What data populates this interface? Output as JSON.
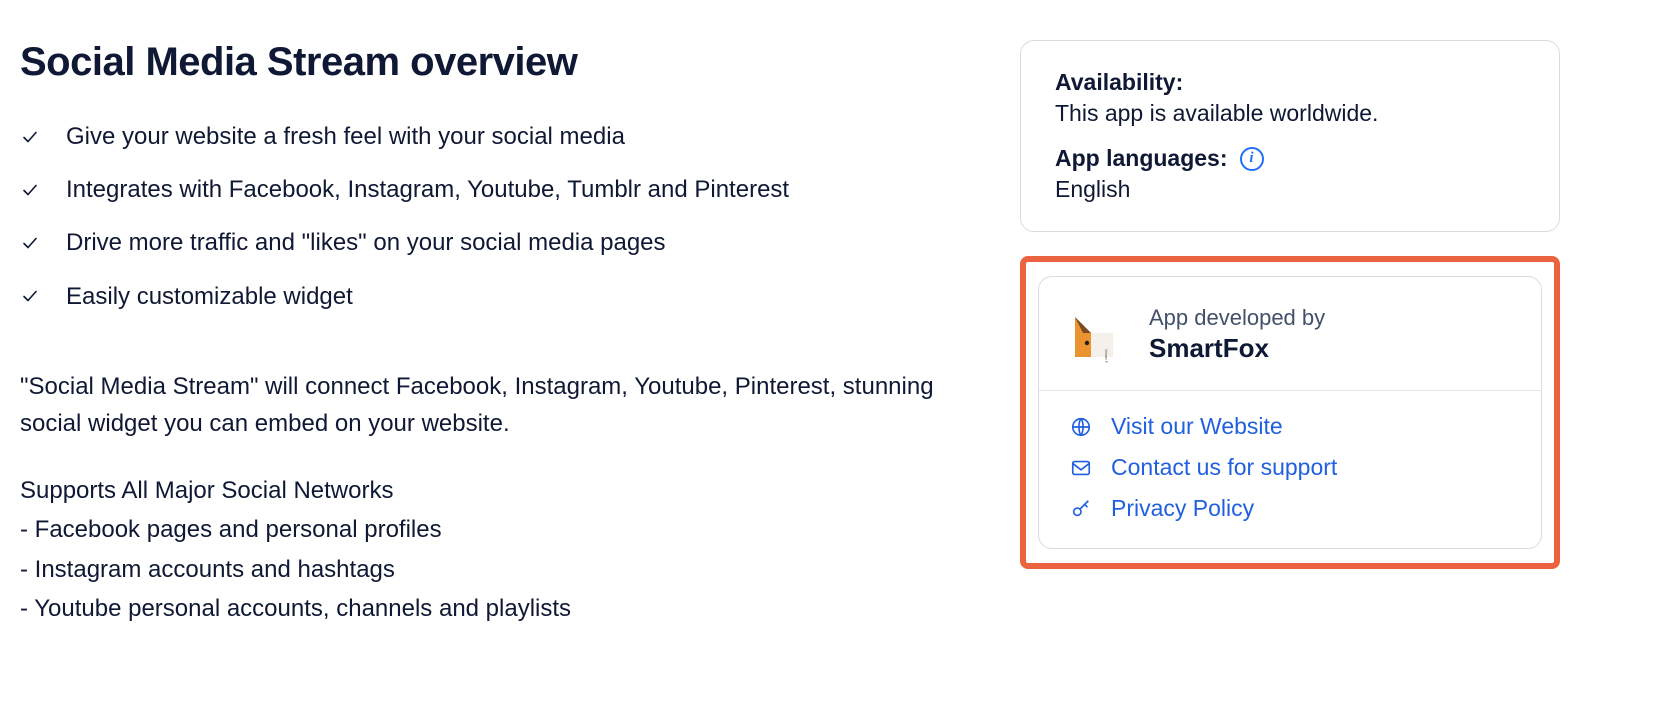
{
  "overview": {
    "title": "Social Media Stream overview",
    "checks": [
      "Give your website a fresh feel with your social media",
      "Integrates with Facebook, Instagram, Youtube, Tumblr and Pinterest",
      "Drive more traffic and \"likes\" on your social media pages",
      "Easily customizable widget"
    ],
    "paragraph": "\"Social Media Stream\" will connect Facebook, Instagram, Youtube, Pinterest, stunning social widget you can embed on your website.",
    "subhead": "Supports All Major Social Networks",
    "support_lines": [
      "- Facebook pages and personal profiles",
      "- Instagram accounts and hashtags",
      "- Youtube personal accounts, channels and playlists"
    ]
  },
  "sidebar": {
    "availability_label": "Availability:",
    "availability_value": "This app is available worldwide.",
    "languages_label": "App languages:",
    "languages_value": "English",
    "developer": {
      "sub": "App developed by",
      "name": "SmartFox"
    },
    "links": {
      "website": "Visit our Website",
      "support": "Contact us for support",
      "privacy": "Privacy Policy"
    }
  }
}
